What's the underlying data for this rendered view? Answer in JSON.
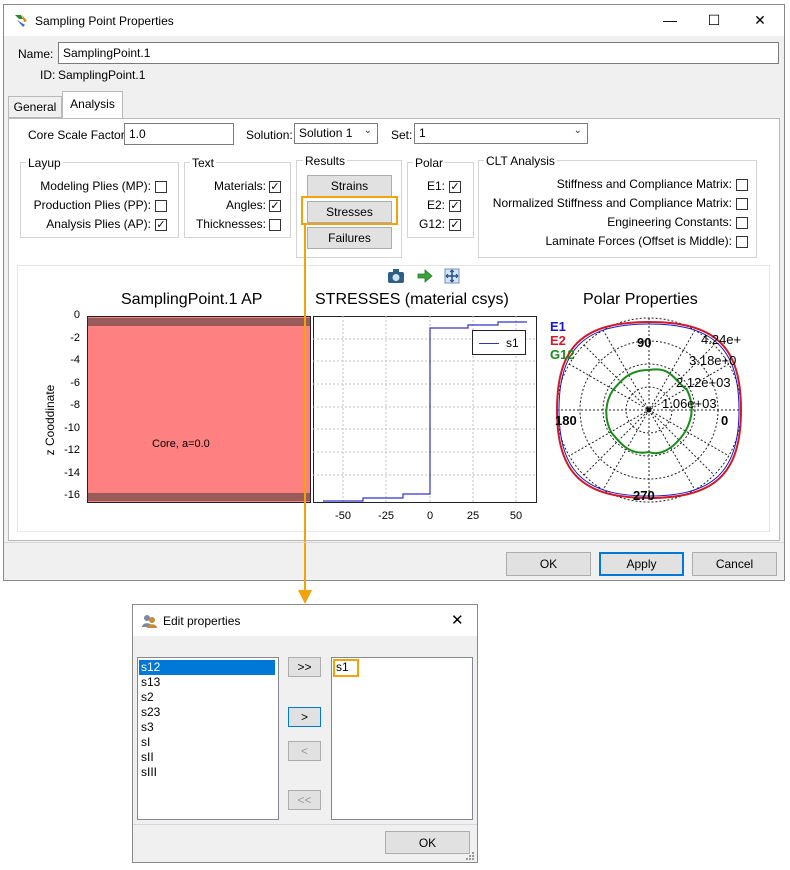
{
  "window": {
    "title": "Sampling Point Properties",
    "minimize_glyph": "—",
    "maximize_glyph": "☐",
    "close_glyph": "✕"
  },
  "form": {
    "name_label": "Name:",
    "name_value": "SamplingPoint.1",
    "id_label": "ID:",
    "id_value": "SamplingPoint.1"
  },
  "tabs": [
    {
      "label": "General",
      "active": false
    },
    {
      "label": "Analysis",
      "active": true
    }
  ],
  "analysis": {
    "core_scale_label": "Core Scale Factor:",
    "core_scale_value": "1.0",
    "solution_label": "Solution:",
    "solution_value": "Solution 1",
    "set_label": "Set:",
    "set_value": "1"
  },
  "layup": {
    "title": "Layup",
    "items": [
      {
        "label": "Modeling Plies (MP):",
        "checked": false
      },
      {
        "label": "Production Plies (PP):",
        "checked": false
      },
      {
        "label": "Analysis Plies (AP):",
        "checked": true
      }
    ]
  },
  "text_group": {
    "title": "Text",
    "items": [
      {
        "label": "Materials:",
        "checked": true
      },
      {
        "label": "Angles:",
        "checked": true
      },
      {
        "label": "Thicknesses:",
        "checked": false
      }
    ]
  },
  "results": {
    "title": "Results",
    "strains_label": "Strains",
    "stresses_label": "Stresses",
    "failures_label": "Failures"
  },
  "polar": {
    "title": "Polar",
    "items": [
      {
        "label": "E1:",
        "checked": true
      },
      {
        "label": "E2:",
        "checked": true
      },
      {
        "label": "G12:",
        "checked": true
      }
    ]
  },
  "clt": {
    "title": "CLT Analysis",
    "items": [
      {
        "label": "Stiffness and Compliance Matrix:",
        "checked": false
      },
      {
        "label": "Normalized Stiffness and Compliance Matrix:",
        "checked": false
      },
      {
        "label": "Engineering Constants:",
        "checked": false
      },
      {
        "label": "Laminate Forces (Offset is Middle):",
        "checked": false
      }
    ]
  },
  "toolbar_icons": [
    "camera-icon",
    "green-arrow-icon",
    "pan-icon"
  ],
  "plots": {
    "layup_title": "SamplingPoint.1 AP",
    "layup_ylabel": "z Cooddinate",
    "layup_yticks": [
      "0",
      "-2",
      "-4",
      "-6",
      "-8",
      "-10",
      "-12",
      "-14",
      "-16"
    ],
    "core_label": "Core, a=0.0",
    "stress_title": "STRESSES (material csys)",
    "stress_xticks": [
      "-50",
      "-25",
      "0",
      "25",
      "50"
    ],
    "legend_label": "s1",
    "polar_title": "Polar Properties",
    "polar_legend": [
      {
        "label": "E1",
        "color": "#1a1ac8"
      },
      {
        "label": "E2",
        "color": "#d01c2a"
      },
      {
        "label": "G12",
        "color": "#1a8a1a"
      }
    ],
    "polar_angles": [
      "90",
      "180",
      "270",
      "0"
    ],
    "polar_radii": [
      "4.24e+",
      "3.18e+0",
      "2.12e+03",
      "1.06e+03"
    ]
  },
  "buttons": {
    "ok": "OK",
    "apply": "Apply",
    "cancel": "Cancel"
  },
  "dialog": {
    "title": "Edit properties",
    "close_glyph": "✕",
    "available": [
      "s12",
      "s13",
      "s2",
      "s23",
      "s3",
      "sI",
      "sII",
      "sIII"
    ],
    "selected_index": 0,
    "chosen": [
      "s1"
    ],
    "add_all": ">>",
    "add": ">",
    "remove": "<",
    "remove_all": "<<",
    "ok": "OK"
  },
  "colors": {
    "accent": "#0078d7",
    "highlight": "#f0a30a",
    "core_fill": "#ff8080",
    "s1_line": "#3333cc"
  }
}
